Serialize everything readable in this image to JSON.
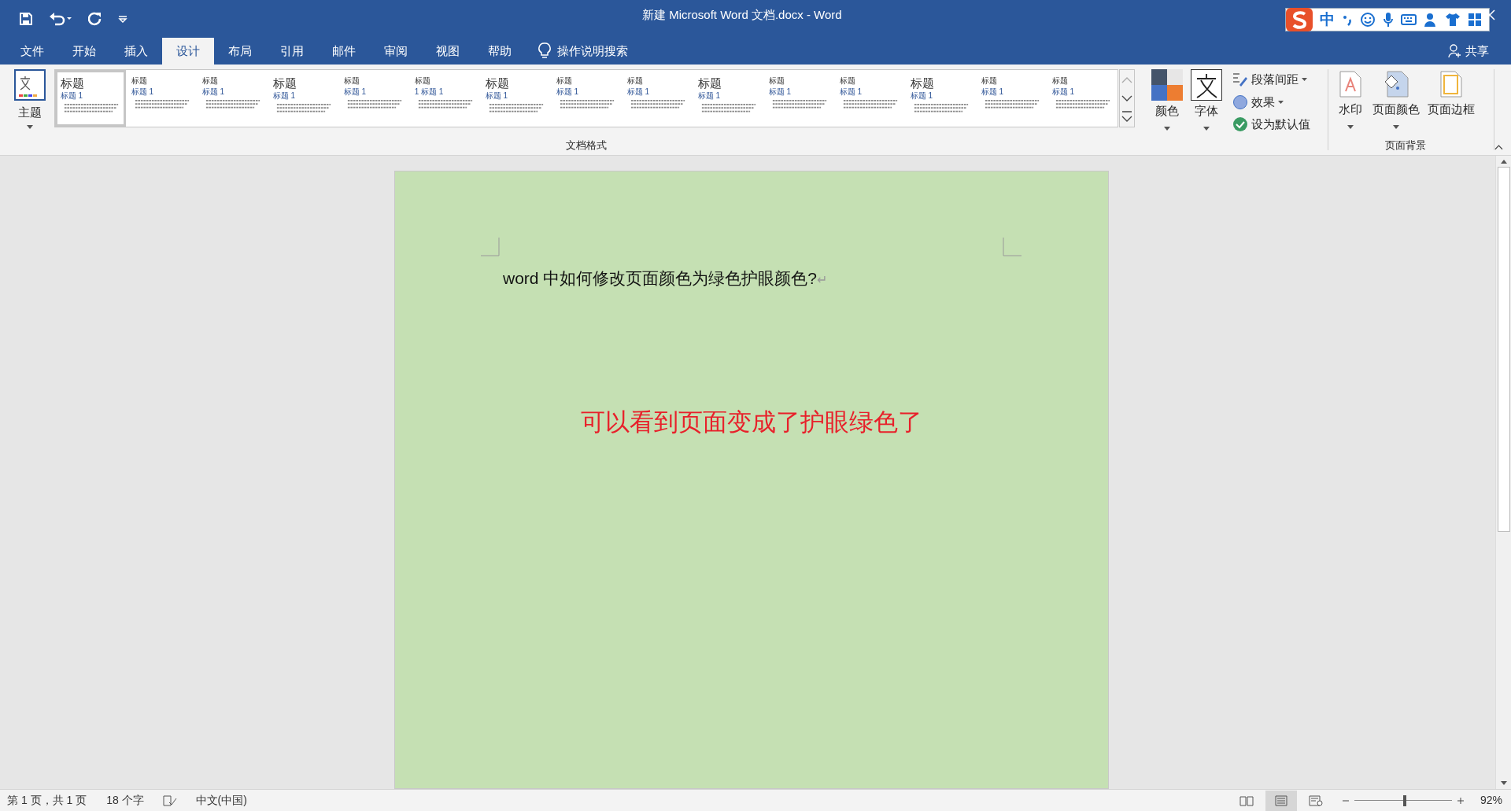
{
  "window": {
    "title": "新建 Microsoft Word 文档.docx  -  Word"
  },
  "ime_bar": {
    "mode": "中"
  },
  "tabs": [
    {
      "label": "文件",
      "selected": false
    },
    {
      "label": "开始",
      "selected": false
    },
    {
      "label": "插入",
      "selected": false
    },
    {
      "label": "设计",
      "selected": true
    },
    {
      "label": "布局",
      "selected": false
    },
    {
      "label": "引用",
      "selected": false
    },
    {
      "label": "邮件",
      "selected": false
    },
    {
      "label": "审阅",
      "selected": false
    },
    {
      "label": "视图",
      "selected": false
    },
    {
      "label": "帮助",
      "selected": false
    }
  ],
  "tell_me": "操作说明搜索",
  "share": "共享",
  "ribbon": {
    "theme_button": "主题",
    "style_gallery": [
      {
        "title": "标题",
        "heading": "标题 1",
        "selected": true
      },
      {
        "title": "标题",
        "heading": "标题 1",
        "selected": false
      },
      {
        "title": "标题",
        "heading": "标题 1",
        "selected": false
      },
      {
        "title": "标题",
        "heading": "标题 1",
        "selected": false
      },
      {
        "title": "标题",
        "heading": "标题 1",
        "selected": false
      },
      {
        "title": "标题",
        "heading": "1  标题 1",
        "selected": false
      },
      {
        "title": "标题",
        "heading": "标题 1",
        "selected": false
      },
      {
        "title": "标题",
        "heading": "标题 1",
        "selected": false
      },
      {
        "title": "标题",
        "heading": "标题 1",
        "selected": false
      },
      {
        "title": "标题",
        "heading": "标题 1",
        "selected": false
      },
      {
        "title": "标题",
        "heading": "标题 1",
        "selected": false
      },
      {
        "title": "标题",
        "heading": "标题 1",
        "selected": false
      },
      {
        "title": "标题",
        "heading": "标题 1",
        "selected": false
      },
      {
        "title": "标题",
        "heading": "标题 1",
        "selected": false
      },
      {
        "title": "标题",
        "heading": "标题 1",
        "selected": false
      }
    ],
    "colors_button": "颜色",
    "fonts_button": "字体",
    "paragraph_spacing": "段落间距",
    "effects": "效果",
    "set_default": "设为默认值",
    "group_document_format": "文档格式",
    "watermark": "水印",
    "page_color": "页面颜色",
    "page_borders": "页面边框",
    "group_page_background": "页面背景"
  },
  "document": {
    "line": "word 中如何修改页面颜色为绿色护眼颜色?",
    "paragraph_mark": "↵",
    "note": "可以看到页面变成了护眼绿色了"
  },
  "status_bar": {
    "page": "第 1 页，共 1 页",
    "words": "18 个字",
    "language": "中文(中国)",
    "zoom_slider": {
      "level": 0.52
    },
    "zoom": "92%"
  }
}
